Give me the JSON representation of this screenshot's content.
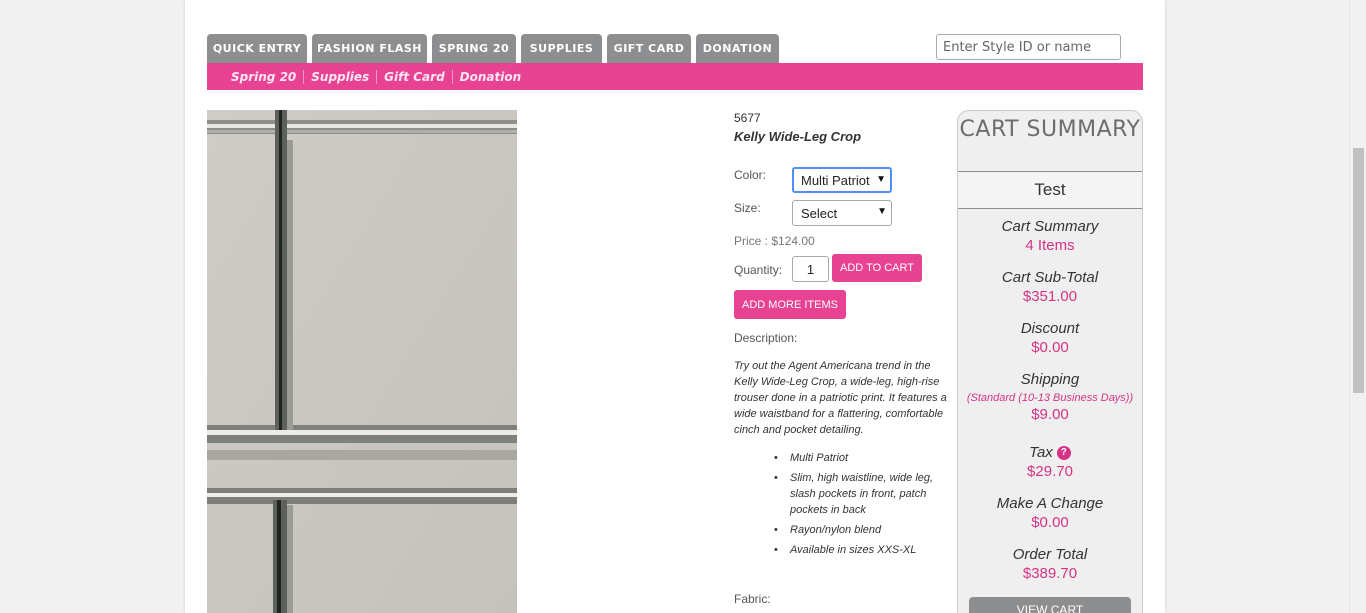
{
  "nav": {
    "tabs": [
      {
        "label": "QUICK ENTRY"
      },
      {
        "label": "FASHION FLASH"
      },
      {
        "label": "SPRING 20"
      },
      {
        "label": "SUPPLIES"
      },
      {
        "label": "GIFT CARD"
      },
      {
        "label": "DONATION"
      }
    ],
    "search_placeholder": "Enter Style ID or name",
    "subnav": [
      {
        "label": "Spring 20"
      },
      {
        "label": "Supplies"
      },
      {
        "label": "Gift Card"
      },
      {
        "label": "Donation"
      }
    ]
  },
  "product": {
    "style_id": "5677",
    "name": "Kelly Wide-Leg Crop",
    "color_label": "Color:",
    "color_value": "Multi Patriot",
    "size_label": "Size:",
    "size_value": "Select",
    "price": "Price : $124.00",
    "quantity_label": "Quantity:",
    "quantity_value": "1",
    "add_to_cart": "ADD TO CART",
    "add_more_items": "ADD MORE ITEMS",
    "description_label": "Description:",
    "description": "Try out the Agent Americana trend in the Kelly Wide-Leg Crop, a wide-leg, high-rise trouser done in a patriotic print. It features a wide waistband for a flattering, comfortable cinch and pocket detailing.",
    "bullets": [
      "Multi Patriot",
      "Slim, high waistline, wide leg, slash pockets in front, patch pockets in back",
      "Rayon/nylon blend",
      "Available in sizes XXS-XL"
    ],
    "fabric_label": "Fabric:"
  },
  "cart": {
    "title": "CART SUMMARY",
    "user": "Test",
    "rows": {
      "summary": {
        "label": "Cart Summary",
        "value": "4 Items"
      },
      "subtotal": {
        "label": "Cart Sub-Total",
        "value": "$351.00"
      },
      "discount": {
        "label": "Discount",
        "value": "$0.00"
      },
      "shipping": {
        "label": "Shipping",
        "note": "(Standard (10-13 Business Days))",
        "value": "$9.00"
      },
      "tax": {
        "label": "Tax",
        "value": "$29.70"
      },
      "change": {
        "label": "Make A Change",
        "value": "$0.00"
      },
      "total": {
        "label": "Order Total",
        "value": "$389.70"
      }
    },
    "view_cart": "VIEW CART"
  },
  "colors": {
    "accent_pink": "#e84393",
    "tab_gray": "#8d8e90",
    "value_pink": "#d63384"
  }
}
